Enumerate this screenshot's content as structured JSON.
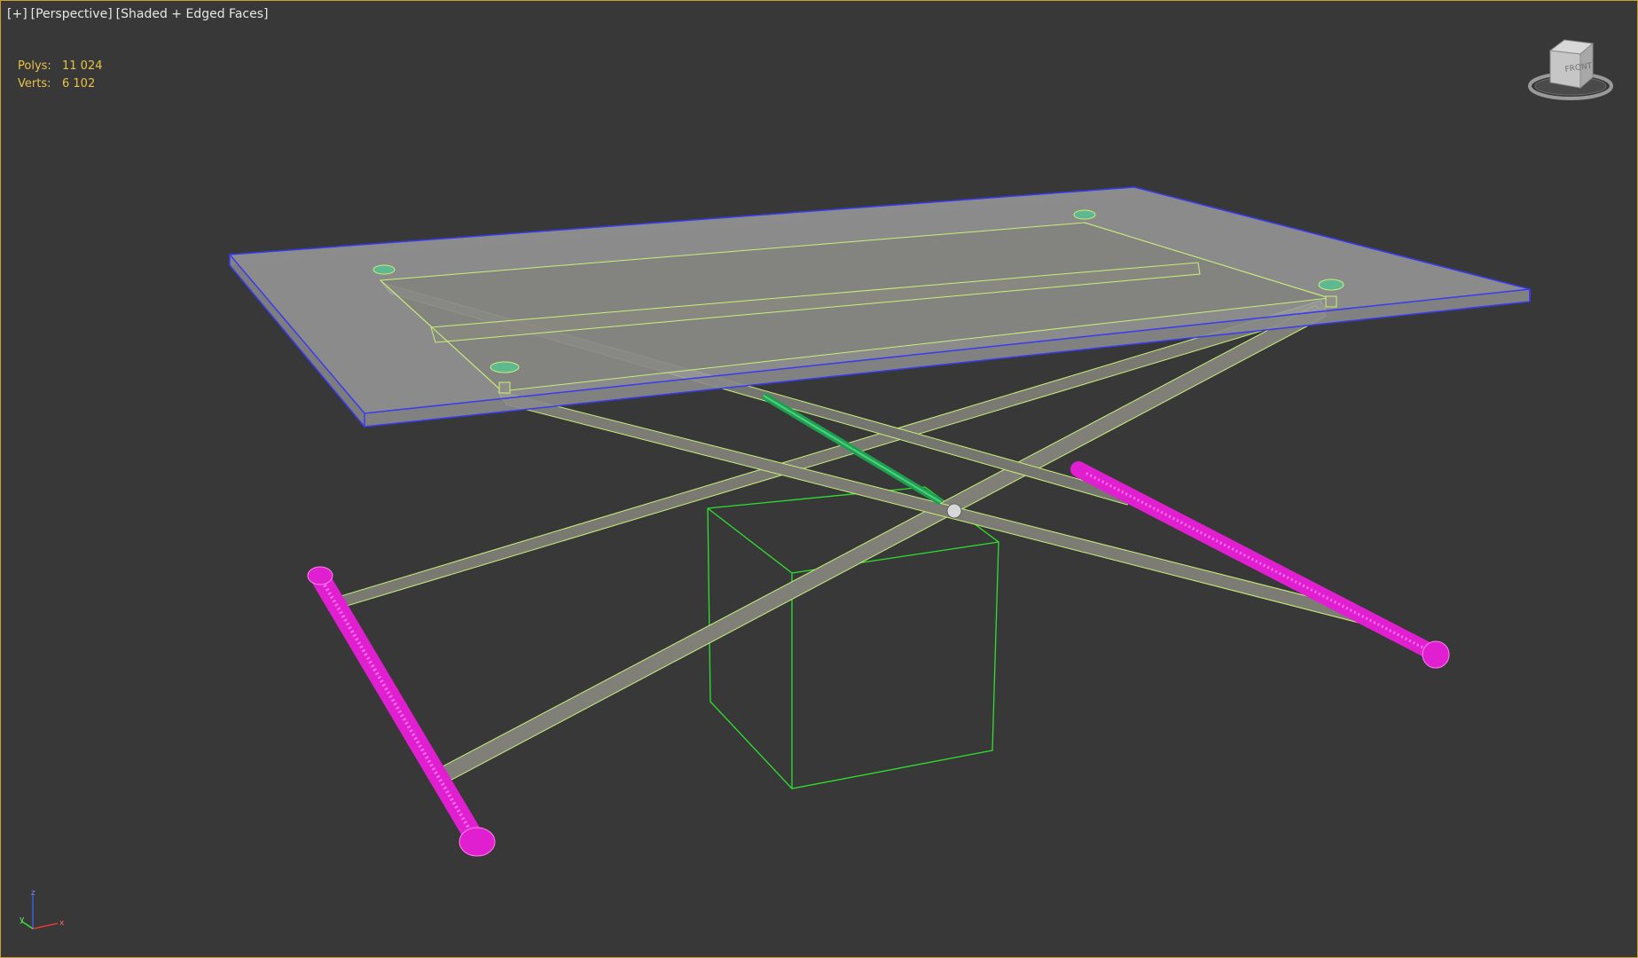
{
  "viewport": {
    "label_plus": "[+]",
    "label_view": "[Perspective]",
    "label_shading": "[Shaded + Edged Faces]",
    "border_color": "#c8a032",
    "background": "#383838"
  },
  "stats": {
    "polys_label": "Polys:",
    "polys_value": "11 024",
    "verts_label": "Verts:",
    "verts_value": "6 102",
    "color": "#e6c24a"
  },
  "viewcube": {
    "face_label": "FRONT",
    "icon": "viewcube-icon"
  },
  "axis_gizmo": {
    "x": "x",
    "y": "y",
    "z": "z"
  },
  "scene": {
    "tabletop_edge_color": "#3a3af0",
    "frame_wire_color": "#c8f07a",
    "selected_rod_color": "#e020d0",
    "green_rod_color": "#1fa050",
    "box_wire_color": "#2ee02e"
  }
}
